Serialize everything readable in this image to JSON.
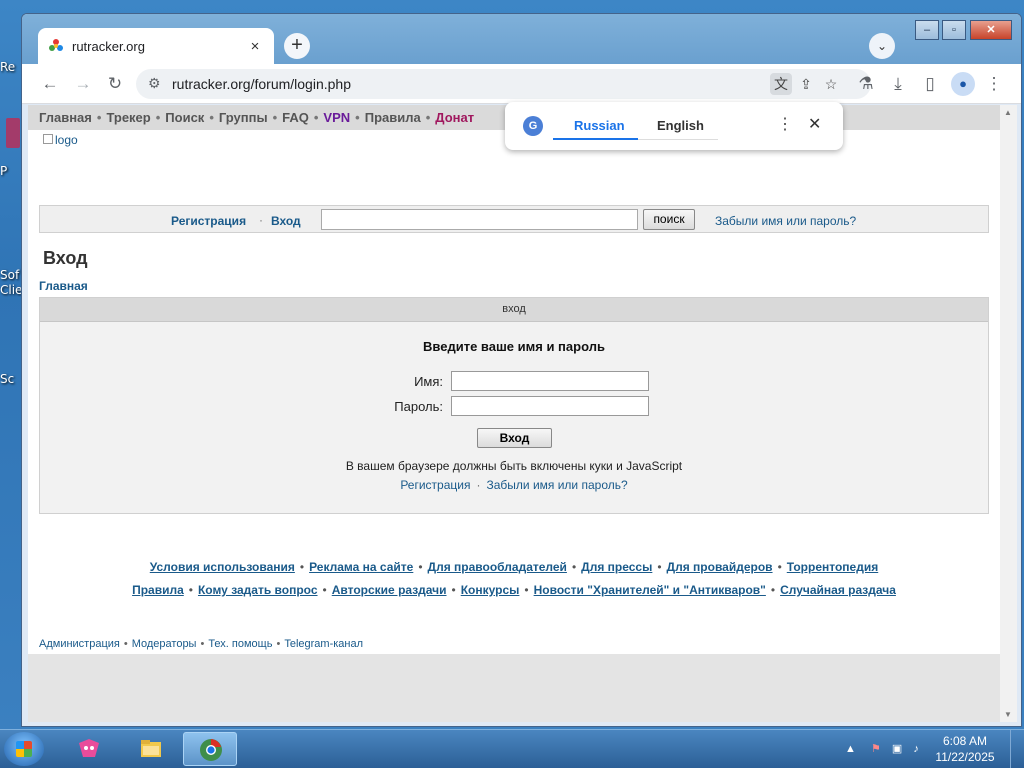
{
  "desktop": {
    "labels": [
      "Re",
      "P",
      "Sof",
      "Clie",
      "Sc"
    ]
  },
  "browser": {
    "tab_title": "rutracker.org",
    "tab_close": "×",
    "new_tab": "+",
    "tab_search": "⌄",
    "window_controls": {
      "minimize": "–",
      "maximize": "▫",
      "close": "✕"
    },
    "url": "rutracker.org/forum/login.php",
    "toolbar_icons": [
      "back-arrow-icon",
      "forward-arrow-icon",
      "reload-icon",
      "site-info-icon",
      "translate-icon",
      "share-icon",
      "star-icon",
      "labs-icon",
      "download-icon",
      "side-panel-icon",
      "profile-icon",
      "menu-icon"
    ]
  },
  "translate_popup": {
    "badge": "G",
    "source_lang": "Russian",
    "target_lang": "English",
    "more": "⋮",
    "close": "✕"
  },
  "site": {
    "topnav": {
      "items": [
        "Главная",
        "Трекер",
        "Поиск",
        "Группы",
        "FAQ",
        "VPN",
        "Правила",
        "Донат"
      ],
      "separator": "•"
    },
    "logo_alt": "logo",
    "searchbar": {
      "register": "Регистрация",
      "login": "Вход",
      "separator": "·",
      "search_value": "",
      "search_button": "поиск",
      "forgot": "Забыли имя или пароль?"
    },
    "page_title": "Вход",
    "breadcrumb": "Главная",
    "login_box": {
      "header": "вход",
      "title": "Введите ваше имя и пароль",
      "username_label": "Имя:",
      "username_value": "",
      "password_label": "Пароль:",
      "password_value": "",
      "submit": "Вход",
      "note": "В вашем браузере должны быть включены куки и JavaScript",
      "register_link": "Регистрация",
      "forgot_link": "Забыли имя или пароль?",
      "separator": "·"
    },
    "footer_row1": [
      "Условия использования",
      "Реклама на сайте",
      "Для правообладателей",
      "Для прессы",
      "Для провайдеров",
      "Торрентопедия"
    ],
    "footer_row2": [
      "Правила",
      "Кому задать вопрос",
      "Авторские раздачи",
      "Конкурсы",
      "Новости \"Хранителей\" и \"Антикваров\"",
      "Случайная раздача"
    ],
    "footer_separator": "•",
    "admin_links": [
      "Администрация",
      "Модераторы",
      "Тех. помощь",
      "Telegram-канал"
    ],
    "admin_separator": "•"
  },
  "taskbar": {
    "items": [
      "start-orb",
      "app-icon-pink",
      "file-explorer-icon",
      "chrome-icon"
    ],
    "tray_arrow": "▲",
    "time": "6:08 AM",
    "date": "11/22/2025"
  },
  "colors": {
    "link": "#1a5a8a",
    "vpn": "#6a1b9a",
    "donate": "#a0185e",
    "translate_accent": "#1a73e8"
  }
}
